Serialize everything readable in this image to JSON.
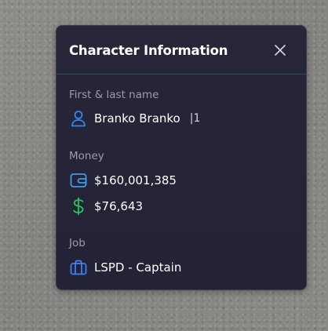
{
  "panel": {
    "title": "Character Information",
    "close_label": "×"
  },
  "name_section": {
    "label": "First & last name",
    "value": "Branko Branko",
    "id_text": "|1",
    "icon": "user-icon",
    "icon_color": "#3b82f6"
  },
  "money_section": {
    "label": "Money",
    "bank": {
      "value": "$160,001,385",
      "icon": "wallet-icon",
      "icon_color": "#3b9eea"
    },
    "cash": {
      "value": "$76,643",
      "icon": "dollar-icon",
      "icon_color": "#22c55e"
    }
  },
  "job_section": {
    "label": "Job",
    "value": "LSPD - Captain",
    "icon": "briefcase-icon",
    "icon_color": "#3b82f6"
  },
  "colors": {
    "panel_bg": "#262537",
    "header_divider": "#2f4470",
    "label_text": "#9c9aad",
    "value_text": "#ffffff"
  }
}
